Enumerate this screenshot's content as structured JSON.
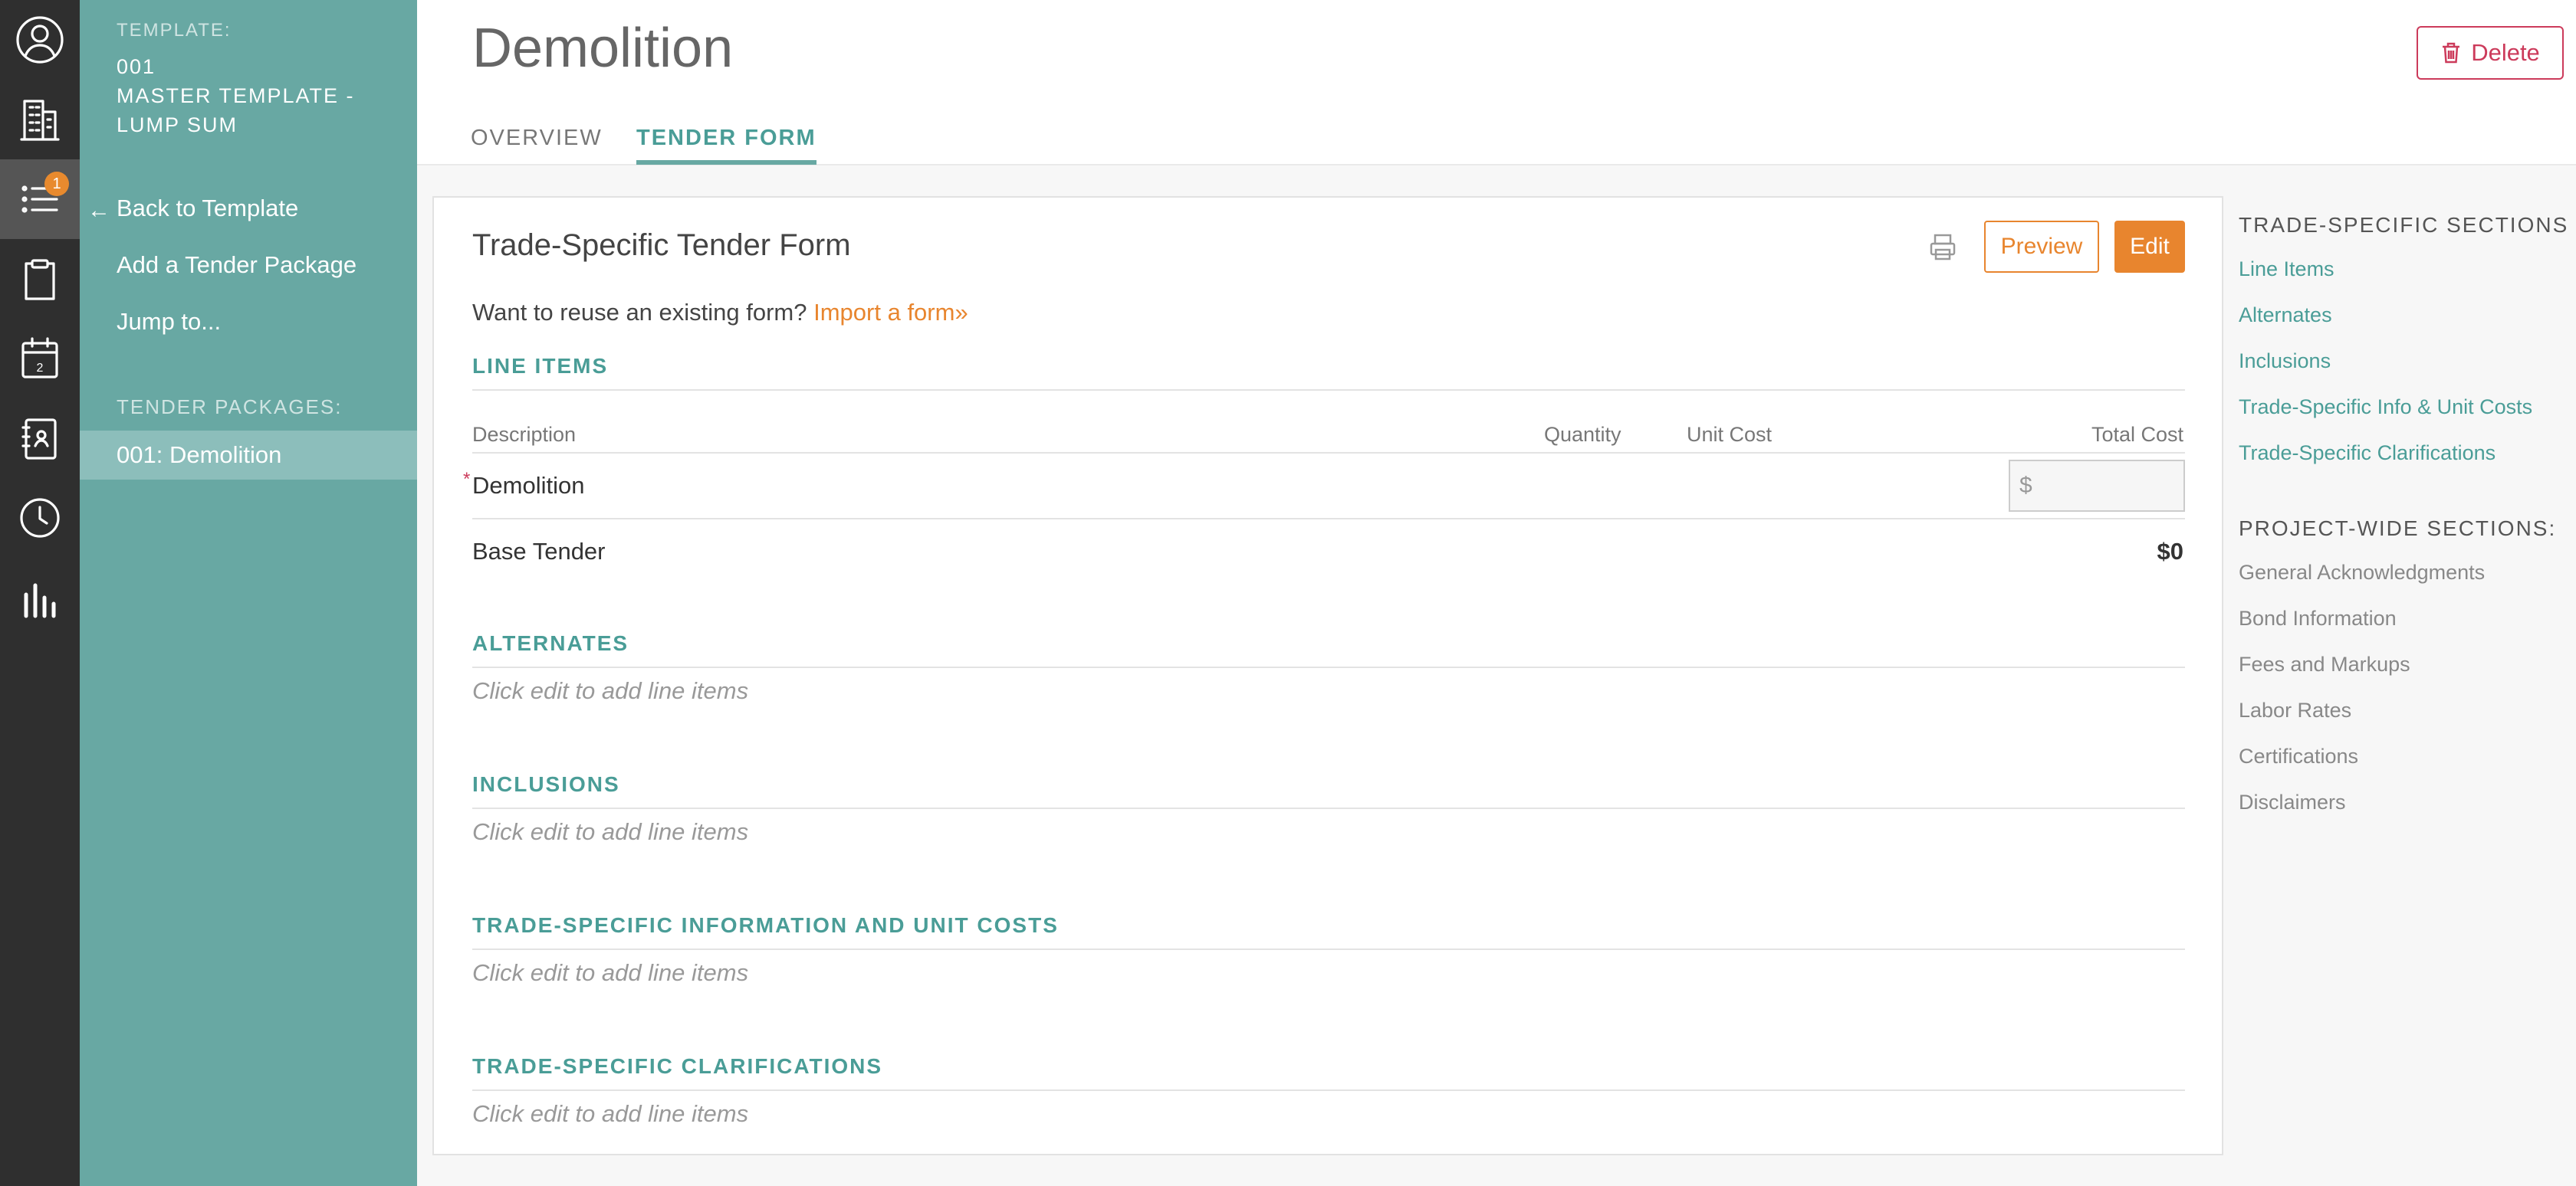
{
  "rail": {
    "items": [
      {
        "icon": "user-icon"
      },
      {
        "icon": "building-icon"
      },
      {
        "icon": "list-icon",
        "badge": "1"
      },
      {
        "icon": "clipboard-icon"
      },
      {
        "icon": "calendar-icon",
        "day": "2"
      },
      {
        "icon": "contact-book-icon"
      },
      {
        "icon": "clock-icon"
      },
      {
        "icon": "bar-chart-icon"
      }
    ]
  },
  "sidebar": {
    "template_label": "TEMPLATE:",
    "template_name": "001\nMASTER TEMPLATE - LUMP SUM",
    "template_number": "001",
    "template_title": "MASTER TEMPLATE - LUMP SUM",
    "back_label": "Back to Template",
    "add_package_label": "Add a Tender Package",
    "jump_label": "Jump to...",
    "packages_label": "TENDER PACKAGES:",
    "packages": [
      {
        "label": "001: Demolition"
      }
    ]
  },
  "header": {
    "title": "Demolition",
    "tabs": [
      {
        "label": "OVERVIEW"
      },
      {
        "label": "TENDER FORM"
      }
    ],
    "delete_label": "Delete"
  },
  "form": {
    "title": "Trade-Specific Tender Form",
    "preview_label": "Preview",
    "edit_label": "Edit",
    "reuse_text": "Want to reuse an existing form?",
    "import_link": "Import a form»",
    "line_items": {
      "heading": "LINE ITEMS",
      "columns": [
        "Description",
        "Quantity",
        "Unit Cost",
        "Total Cost"
      ],
      "rows": [
        {
          "description": "Demolition",
          "total_placeholder": "$"
        }
      ],
      "base_label": "Base Tender",
      "base_value": "$0"
    },
    "sections": [
      {
        "heading": "ALTERNATES",
        "placeholder": "Click edit to add line items"
      },
      {
        "heading": "INCLUSIONS",
        "placeholder": "Click edit to add line items"
      },
      {
        "heading": "TRADE-SPECIFIC INFORMATION AND UNIT COSTS",
        "placeholder": "Click edit to add line items"
      },
      {
        "heading": "TRADE-SPECIFIC CLARIFICATIONS",
        "placeholder": "Click edit to add line items"
      }
    ]
  },
  "right_panel": {
    "trade_heading": "TRADE-SPECIFIC SECTIONS",
    "trade_links": [
      "Line Items",
      "Alternates",
      "Inclusions",
      "Trade-Specific Info & Unit Costs",
      "Trade-Specific Clarifications"
    ],
    "project_heading": "PROJECT-WIDE SECTIONS:",
    "project_links": [
      "General Acknowledgments",
      "Bond Information",
      "Fees and Markups",
      "Labor Rates",
      "Certifications",
      "Disclaimers"
    ]
  },
  "colors": {
    "teal": "#68a8a3",
    "teal_text": "#4a9d97",
    "orange": "#e8852e",
    "red": "#cc3b5b",
    "rail": "#2f2f2f"
  }
}
